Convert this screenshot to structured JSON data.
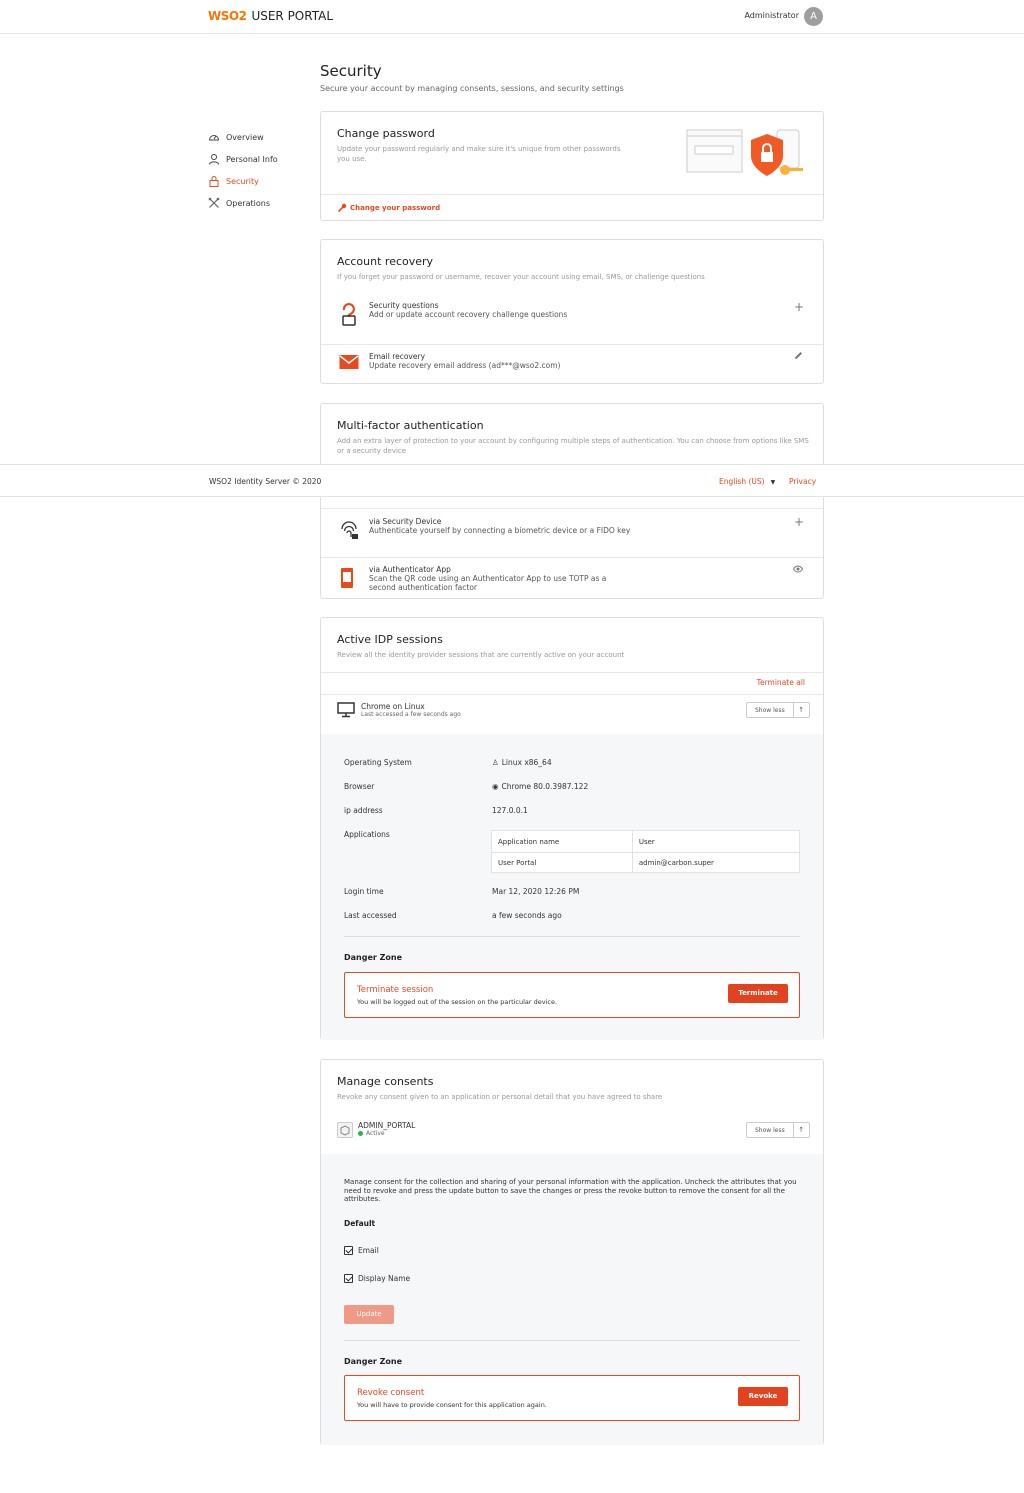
{
  "header": {
    "logo_text": "WSO2",
    "app_title": "USER PORTAL",
    "user_name": "Administrator",
    "avatar_letter": "A"
  },
  "page": {
    "title": "Security",
    "subtitle": "Secure your account by managing consents, sessions, and security settings"
  },
  "sidebar": {
    "items": [
      {
        "label": "Overview",
        "icon": "dashboard-icon"
      },
      {
        "label": "Personal Info",
        "icon": "user-icon"
      },
      {
        "label": "Security",
        "icon": "lock-icon",
        "active": true
      },
      {
        "label": "Operations",
        "icon": "tools-icon"
      }
    ]
  },
  "change_password": {
    "title": "Change password",
    "desc": "Update your password regularly and make sure it's unique from other passwords you use.",
    "link": "Change your password"
  },
  "account_recovery": {
    "title": "Account recovery",
    "desc": "If you forget your password or username, recover your account using email, SMS, or challenge questions",
    "items": [
      {
        "title": "Security questions",
        "desc": "Add or update account recovery challenge questions"
      },
      {
        "title": "Email recovery",
        "desc": "Update recovery email address (ad***@wso2.com)"
      }
    ]
  },
  "mfa": {
    "title": "Multi-factor authentication",
    "desc": "Add an extra layer of protection to your account by configuring multiple steps of authentication. You can choose from options like SMS or a security device",
    "items": [
      {
        "title": "via Security Device",
        "desc": "Authenticate yourself by connecting a biometric device or a FIDO key"
      },
      {
        "title": "via Authenticator App",
        "desc": "Scan the QR code using an Authenticator App to use TOTP as a second authentication factor"
      }
    ]
  },
  "footer": {
    "copyright": "WSO2 Identity Server © 2020",
    "language": "English (US)",
    "privacy": "Privacy"
  },
  "sessions": {
    "title": "Active IDP sessions",
    "desc": "Review all the identity provider sessions that are currently active on your account",
    "terminate_all": "Terminate all",
    "session": {
      "name": "Chrome on Linux",
      "last": "Last accessed a few seconds ago",
      "toggle": "Show less"
    },
    "details": {
      "os_label": "Operating System",
      "os_value": "Linux x86_64",
      "browser_label": "Browser",
      "browser_value": "Chrome 80.0.3987.122",
      "ip_label": "ip address",
      "ip_value": "127.0.0.1",
      "apps_label": "Applications",
      "apps_columns": [
        "Application name",
        "User"
      ],
      "apps_rows": [
        [
          "User Portal",
          "admin@carbon.super"
        ]
      ],
      "login_label": "Login time",
      "login_value": "Mar 12, 2020 12:26 PM",
      "last_label": "Last accessed",
      "last_value": "a few seconds ago"
    },
    "danger_zone": "Danger Zone",
    "danger_title": "Terminate session",
    "danger_desc": "You will be logged out of the session on the particular device.",
    "danger_button": "Terminate"
  },
  "consents": {
    "title": "Manage consents",
    "desc": "Revoke any consent given to an application or personal detail that you have agreed to share",
    "app_name": "ADMIN_PORTAL",
    "app_status": "Active",
    "toggle": "Show less",
    "info": "Manage consent for the collection and sharing of your personal information with the application. Uncheck the attributes that you need to revoke and press the update button to save the changes or press the revoke button to remove the consent for all the attributes.",
    "group": "Default",
    "attributes": [
      "Email",
      "Display Name"
    ],
    "update_button": "Update",
    "danger_zone": "Danger Zone",
    "danger_title": "Revoke consent",
    "danger_desc": "You will have to provide consent for this application again.",
    "danger_button": "Revoke"
  }
}
